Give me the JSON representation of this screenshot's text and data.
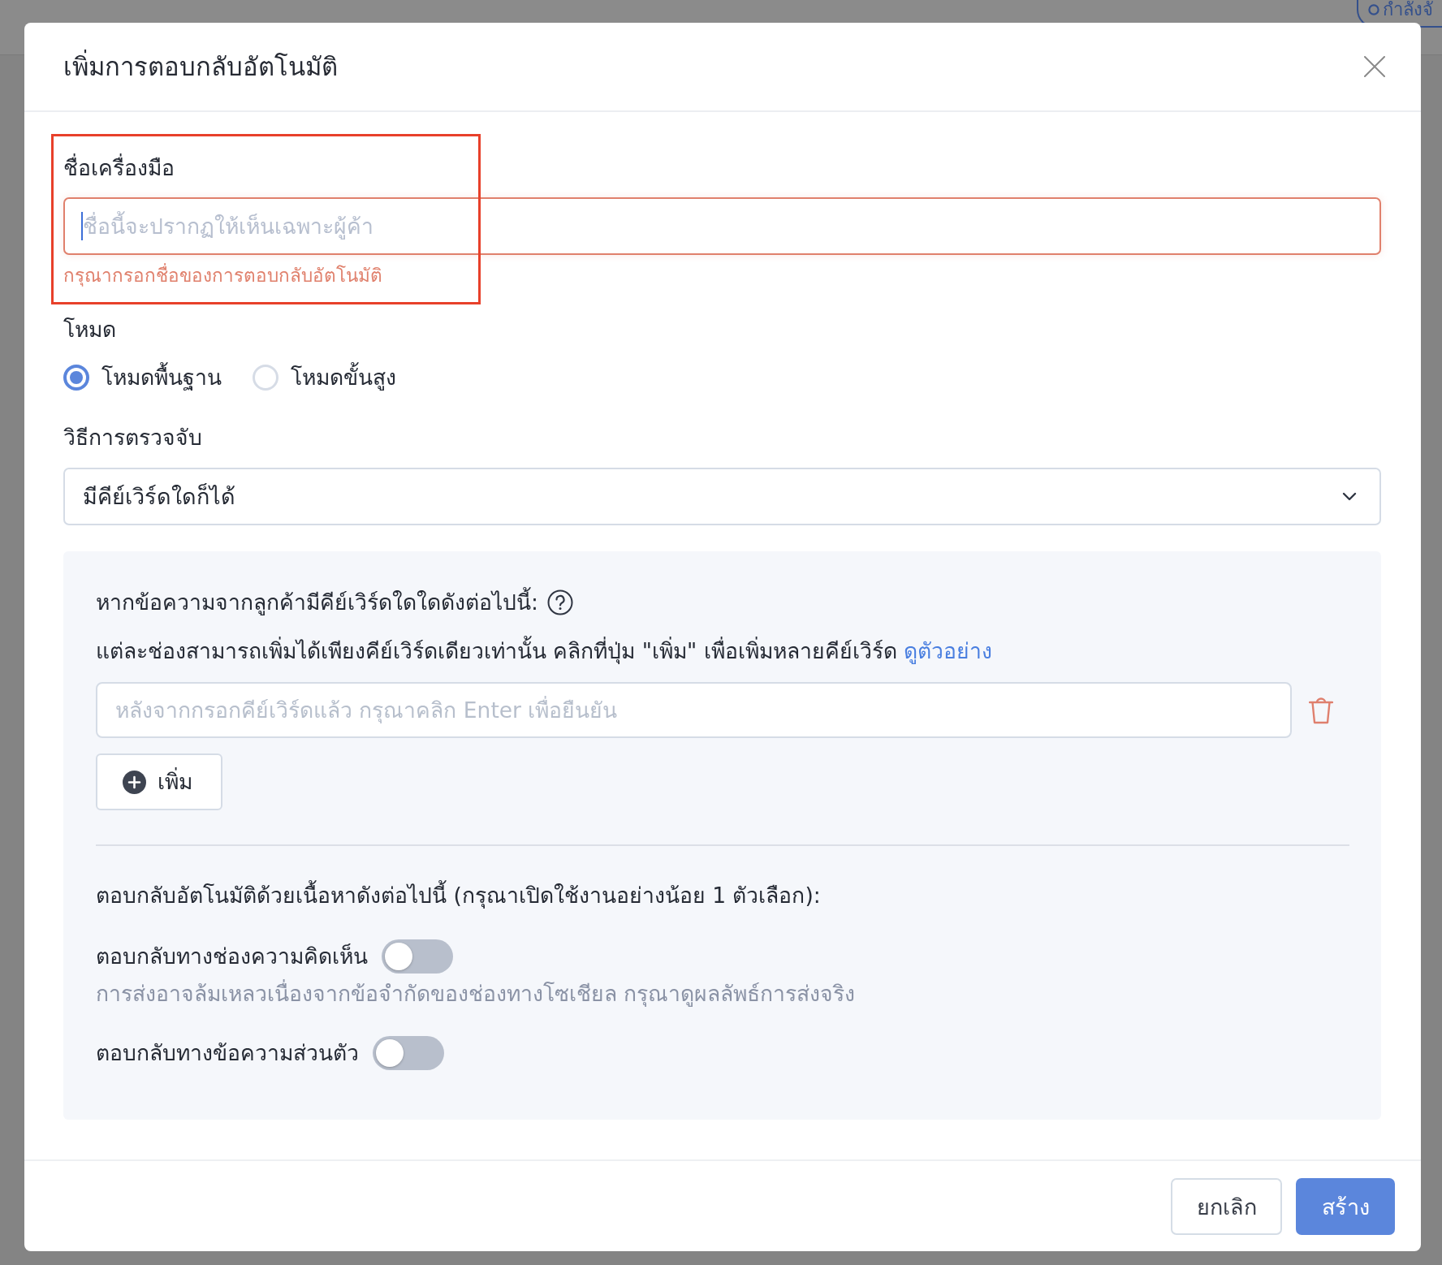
{
  "background": {
    "status_badge": "กำลังจั"
  },
  "dialog": {
    "title": "เพิ่มการตอบกลับอัตโนมัติ"
  },
  "tool_name": {
    "label": "ชื่อเครื่องมือ",
    "placeholder": "ชื่อนี้จะปรากฏให้เห็นเฉพาะผู้ค้า",
    "focused": true,
    "error": "กรุณากรอกชื่อของการตอบกลับอัตโนมัติ",
    "highlighted": true
  },
  "mode": {
    "label": "โหมด",
    "options": [
      {
        "label": "โหมดพื้นฐาน",
        "selected": true
      },
      {
        "label": "โหมดขั้นสูง",
        "selected": false
      }
    ]
  },
  "detection": {
    "label": "วิธีการตรวจจับ",
    "value": "มีคีย์เวิร์ดใดก็ได้"
  },
  "keywords": {
    "heading": "หากข้อความจากลูกค้ามีคีย์เวิร์ดใดใดดังต่อไปนี้:",
    "note": "แต่ละช่องสามารถเพิ่มได้เพียงคีย์เวิร์ดเดียวเท่านั้น คลิกที่ปุ่ม \"เพิ่ม\" เพื่อเพิ่มหลายคีย์เวิร์ด",
    "link": "ดูตัวอย่าง",
    "fields": [
      {
        "placeholder": "หลังจากกรอกคีย์เวิร์ดแล้ว กรุณาคลิก Enter เพื่อยืนยัน"
      }
    ],
    "add_button": "เพิ่ม"
  },
  "replies": {
    "heading": "ตอบกลับอัตโนมัติด้วยเนื้อหาดังต่อไปนี้ (กรุณาเปิดใช้งานอย่างน้อย 1 ตัวเลือก):",
    "options": [
      {
        "label": "ตอบกลับทางช่องความคิดเห็น",
        "on": false,
        "hint": "การส่งอาจล้มเหลวเนื่องจากข้อจำกัดของช่องทางโซเชียล กรุณาดูผลลัพธ์การส่งจริง"
      },
      {
        "label": "ตอบกลับทางข้อความส่วนตัว",
        "on": false
      }
    ]
  },
  "buttons": [
    {
      "label": "ยกเลิก",
      "kind": "secondary"
    },
    {
      "label": "สร้าง",
      "kind": "primary"
    }
  ]
}
